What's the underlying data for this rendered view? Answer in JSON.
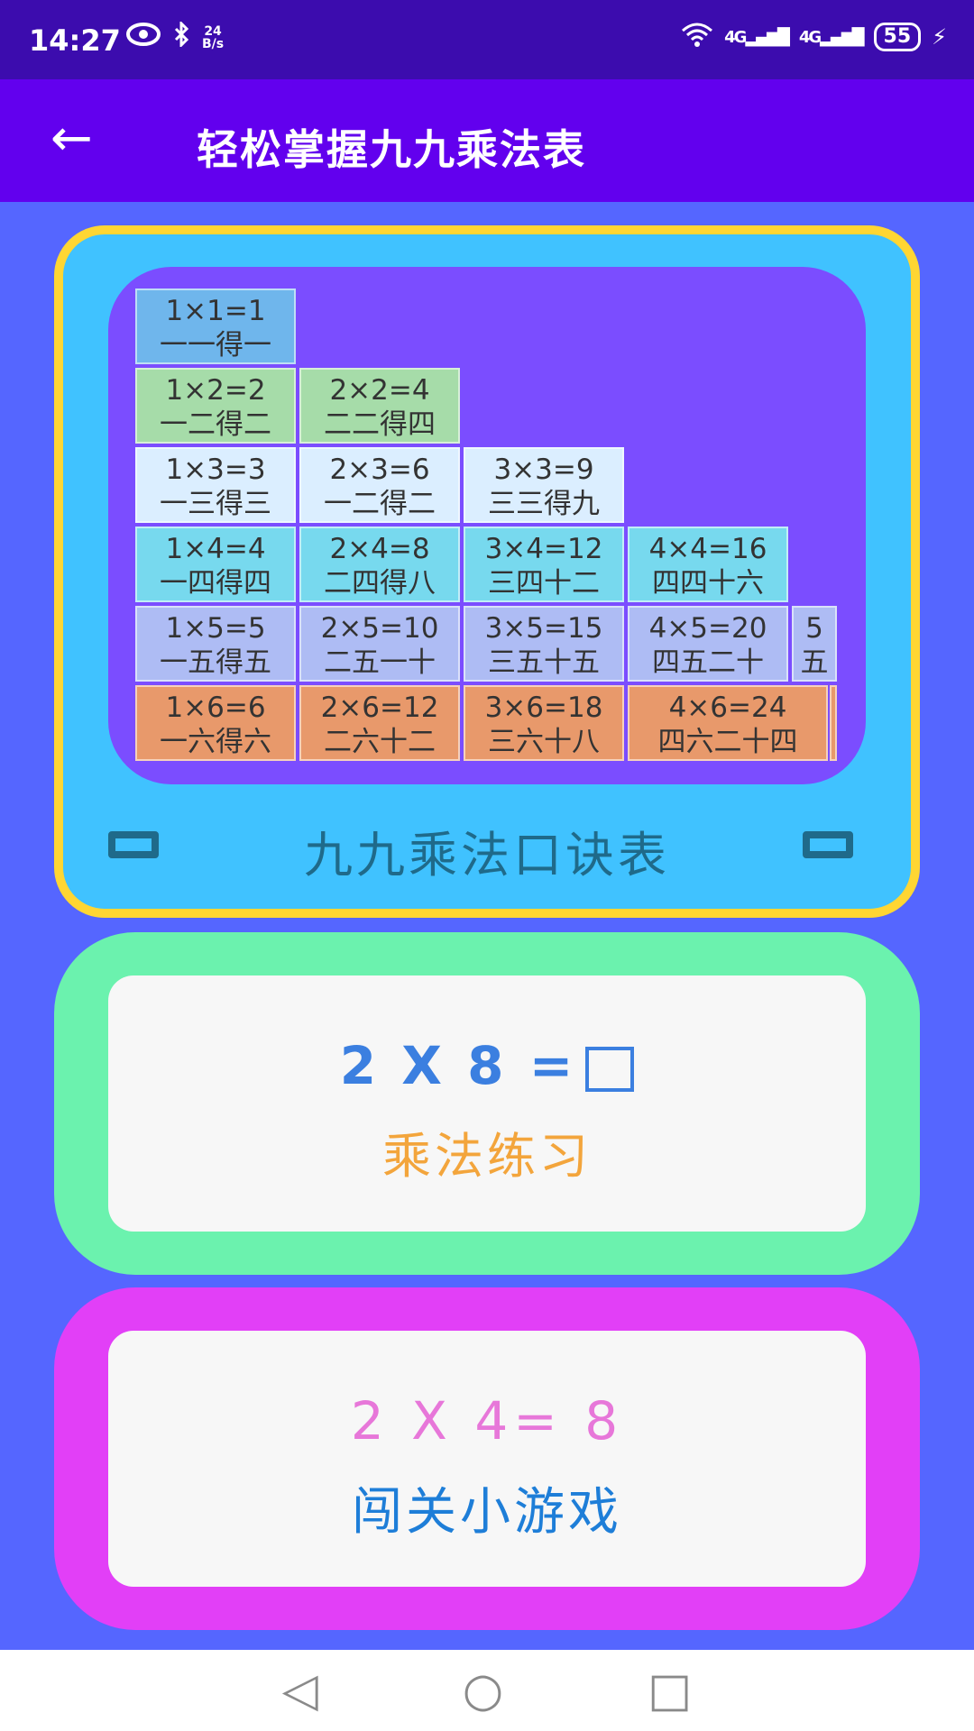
{
  "status_bar": {
    "time": "14:27",
    "speed_top": "24",
    "speed_bottom": "B/s",
    "net1": "4G",
    "net2": "4G",
    "battery": "55"
  },
  "app_bar": {
    "title": "轻松掌握九九乘法表"
  },
  "multiplication_card": {
    "title": "九九乘法口诀表",
    "cells": [
      {
        "eq": "1×1=1",
        "verse": "一一得一"
      },
      {
        "eq": "1×2=2",
        "verse": "一二得二"
      },
      {
        "eq": "2×2=4",
        "verse": "二二得四"
      },
      {
        "eq": "1×3=3",
        "verse": "一三得三"
      },
      {
        "eq": "2×3=6",
        "verse": "一二得二"
      },
      {
        "eq": "3×3=9",
        "verse": "三三得九"
      },
      {
        "eq": "1×4=4",
        "verse": "一四得四"
      },
      {
        "eq": "2×4=8",
        "verse": "二四得八"
      },
      {
        "eq": "3×4=12",
        "verse": "三四十二"
      },
      {
        "eq": "4×4=16",
        "verse": "四四十六"
      },
      {
        "eq": "1×5=5",
        "verse": "一五得五"
      },
      {
        "eq": "2×5=10",
        "verse": "二五一十"
      },
      {
        "eq": "3×5=15",
        "verse": "三五十五"
      },
      {
        "eq": "4×5=20",
        "verse": "四五二十"
      },
      {
        "eq": "5",
        "verse": "五"
      },
      {
        "eq": "1×6=6",
        "verse": "一六得六"
      },
      {
        "eq": "2×6=12",
        "verse": "二六十二"
      },
      {
        "eq": "3×6=18",
        "verse": "三六十八"
      },
      {
        "eq": "4×6=24",
        "verse": "四六二十四"
      }
    ]
  },
  "practice_card": {
    "equation": "2 X 8 =",
    "label": "乘法练习"
  },
  "game_card": {
    "equation": "2 X 4= 8",
    "label": "闯关小游戏"
  },
  "nav_bar": {
    "back": "◁",
    "home": "○",
    "recents": "□"
  }
}
